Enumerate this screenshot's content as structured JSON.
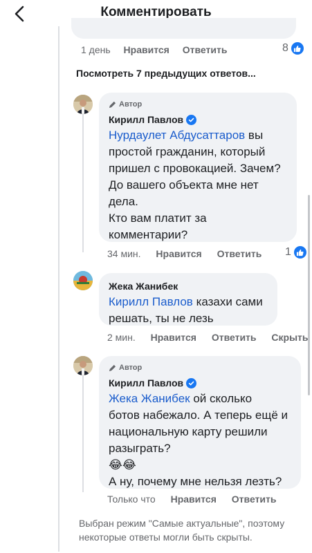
{
  "header": {
    "title": "Комментировать"
  },
  "top_comment": {
    "time": "1 день",
    "like_label": "Нравится",
    "reply_label": "Ответить",
    "likes": "8"
  },
  "view_more": "Посмотреть 7 предыдущих ответов...",
  "comments": [
    {
      "author_badge": "Автор",
      "name": "Кирилл Павлов",
      "mention": "Нурдаулет Абдусаттаров",
      "lines": [
        "вы",
        "простой гражданин, который",
        "пришел с провокацией. Зачем?",
        "До вашего объекта мне нет",
        "дела.",
        "Кто вам платит за",
        "комментарии?"
      ],
      "time": "34 мин.",
      "like_label": "Нравится",
      "reply_label": "Ответить",
      "likes": "1"
    },
    {
      "name": "Жека Жанибек",
      "mention": "Кирилл Павлов",
      "lines": [
        "казахи сами",
        "решать, ты не лезь"
      ],
      "time": "2 мин.",
      "like_label": "Нравится",
      "reply_label": "Ответить",
      "hide_label": "Скрыть"
    },
    {
      "author_badge": "Автор",
      "name": "Кирилл Павлов",
      "mention": "Жека Жанибек",
      "lines": [
        "ой сколько",
        "ботов набежало. А теперь ещё и",
        "национальную карту решили",
        "разыграть?",
        "😂😂",
        "А ну, почему мне нельзя лезть?"
      ],
      "time": "Только что",
      "like_label": "Нравится",
      "reply_label": "Ответить"
    }
  ],
  "footer_note": "Выбран режим \"Самые актуальные\", поэтому некоторые ответы могли быть скрыты.",
  "colors": {
    "accent": "#1877f2",
    "mention": "#1a5ccc",
    "bubble": "#f0f2f5",
    "muted": "#65676b"
  },
  "icons": [
    "back-arrow-icon",
    "like-icon",
    "pencil-icon",
    "verified-icon"
  ]
}
